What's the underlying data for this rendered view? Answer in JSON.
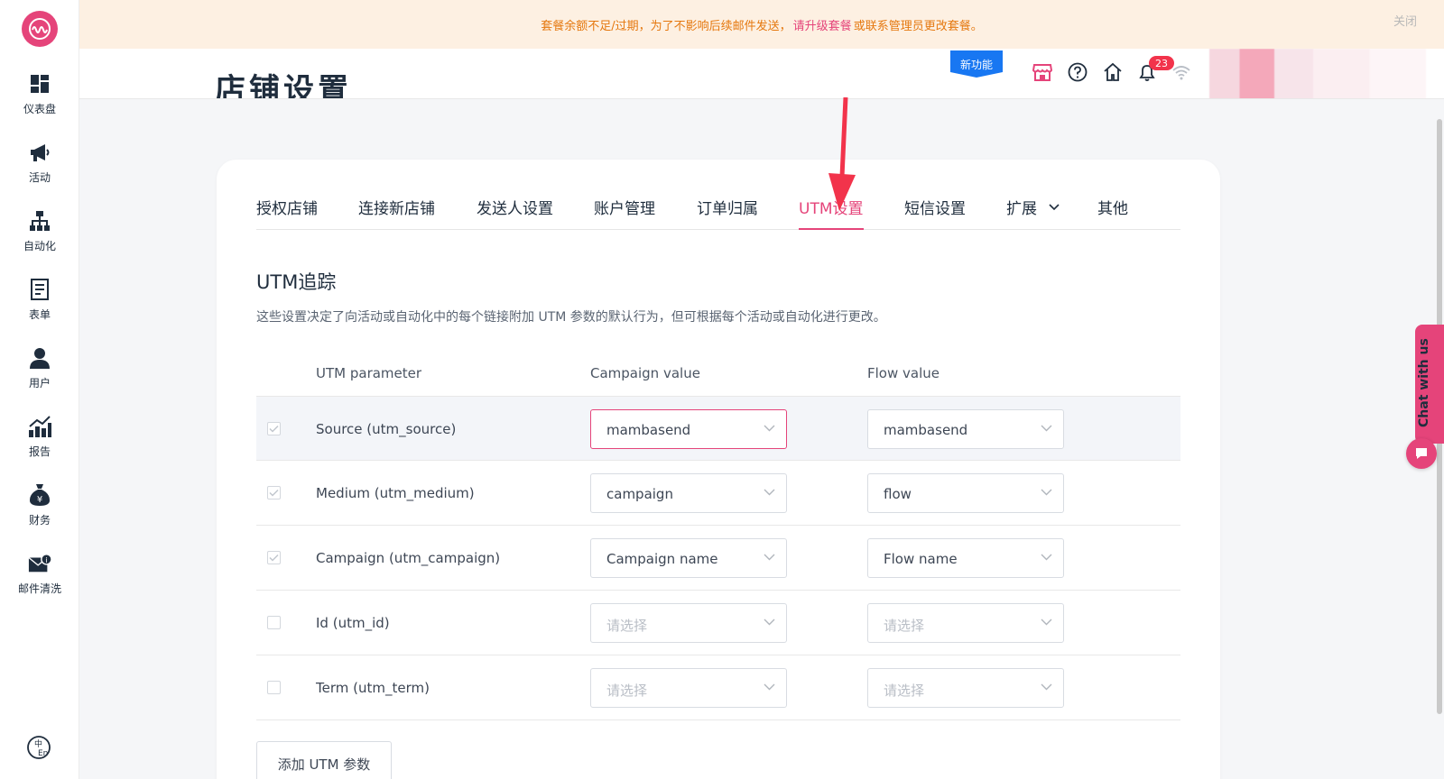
{
  "banner": {
    "text_before": "套餐余额不足/过期，为了不影响后续邮件发送，",
    "link": "请升级套餐",
    "text_after": "或联系管理员更改套餐。",
    "close": "关闭"
  },
  "sidebar": {
    "items": [
      {
        "label": "仪表盘",
        "icon": "dashboard-icon"
      },
      {
        "label": "活动",
        "icon": "megaphone-icon"
      },
      {
        "label": "自动化",
        "icon": "flow-tree-icon"
      },
      {
        "label": "表单",
        "icon": "form-icon"
      },
      {
        "label": "用户",
        "icon": "user-icon"
      },
      {
        "label": "报告",
        "icon": "report-chart-icon"
      },
      {
        "label": "财务",
        "icon": "money-bag-icon"
      },
      {
        "label": "邮件清洗",
        "icon": "mail-clean-icon"
      }
    ]
  },
  "header": {
    "page_title": "店铺设置",
    "new_feature": "新功能",
    "notification_count": "23"
  },
  "tabs": [
    {
      "label": "授权店铺"
    },
    {
      "label": "连接新店铺"
    },
    {
      "label": "发送人设置"
    },
    {
      "label": "账户管理"
    },
    {
      "label": "订单归属"
    },
    {
      "label": "UTM设置",
      "active": true
    },
    {
      "label": "短信设置"
    },
    {
      "label": "扩展"
    },
    {
      "label": "其他"
    }
  ],
  "section": {
    "title": "UTM追踪",
    "description": "这些设置决定了向活动或自动化中的每个链接附加 UTM 参数的默认行为，但可根据每个活动或自动化进行更改。"
  },
  "table": {
    "headers": {
      "param": "UTM parameter",
      "campaign": "Campaign value",
      "flow": "Flow value"
    },
    "rows": [
      {
        "param": "Source (utm_source)",
        "checked": true,
        "campaign": "mambasend",
        "flow": "mambasend"
      },
      {
        "param": "Medium (utm_medium)",
        "checked": true,
        "campaign": "campaign",
        "flow": "flow"
      },
      {
        "param": "Campaign (utm_campaign)",
        "checked": true,
        "campaign": "Campaign name",
        "flow": "Flow name"
      },
      {
        "param": "Id (utm_id)",
        "checked": false,
        "campaign": "请选择",
        "flow": "请选择"
      },
      {
        "param": "Term (utm_term)",
        "checked": false,
        "campaign": "请选择",
        "flow": "请选择"
      }
    ]
  },
  "add_button": "添加 UTM 参数",
  "chat": {
    "label": "Chat with us"
  },
  "colors": {
    "accent": "#e5447a",
    "banner_bg": "#fdf0e2",
    "banner_text": "#e5780f",
    "new_badge": "#1877f2",
    "notif_badge": "#f2334b"
  }
}
